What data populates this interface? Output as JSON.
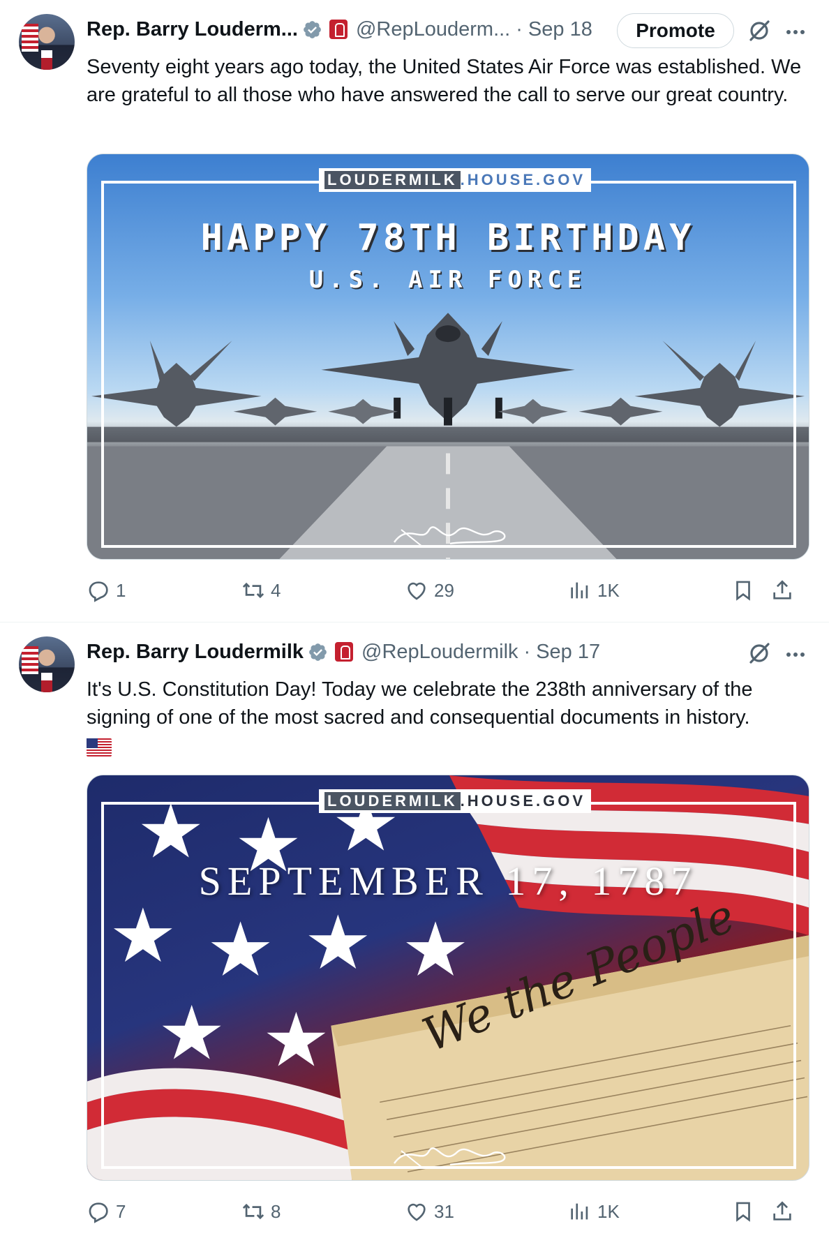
{
  "tweets": [
    {
      "author_name": "Rep. Barry Louderm...",
      "handle": "@RepLouderm...",
      "separator": "·",
      "date": "Sep 18",
      "promote_label": "Promote",
      "text": "Seventy eight years ago today, the United States Air Force was established. We are grateful to all those who have answered the call to serve our great country.",
      "media": {
        "site_tag_a": "LOUDERMILK",
        "site_tag_b": ".HOUSE.GOV",
        "title": "HAPPY 78TH BIRTHDAY",
        "subtitle": "U.S. AIR FORCE"
      },
      "stats": {
        "replies": "1",
        "reposts": "4",
        "likes": "29",
        "views": "1K"
      }
    },
    {
      "author_name": "Rep. Barry Loudermilk",
      "handle": "@RepLoudermilk",
      "separator": "·",
      "date": "Sep 17",
      "text": "It's U.S. Constitution Day! Today we celebrate the 238th anniversary of the signing of one of the most sacred and consequential documents in history.",
      "media": {
        "site_tag_a": "LOUDERMILK",
        "site_tag_b": ".HOUSE.GOV",
        "title": "SEPTEMBER 17, 1787",
        "document_text": "We the People"
      },
      "stats": {
        "replies": "7",
        "reposts": "8",
        "likes": "31",
        "views": "1K"
      }
    }
  ],
  "icons": {
    "verified": "verified-badge-icon",
    "gov": "government-badge-icon",
    "grok": "grok-icon",
    "more": "more-icon",
    "reply": "reply-icon",
    "repost": "repost-icon",
    "like": "like-icon",
    "views": "views-icon",
    "bookmark": "bookmark-icon",
    "share": "share-icon"
  },
  "colors": {
    "text_primary": "#0f1419",
    "text_secondary": "#536471",
    "verified_blue": "#829aab",
    "gov_red": "#c4202f",
    "divider": "#eff3f4"
  }
}
